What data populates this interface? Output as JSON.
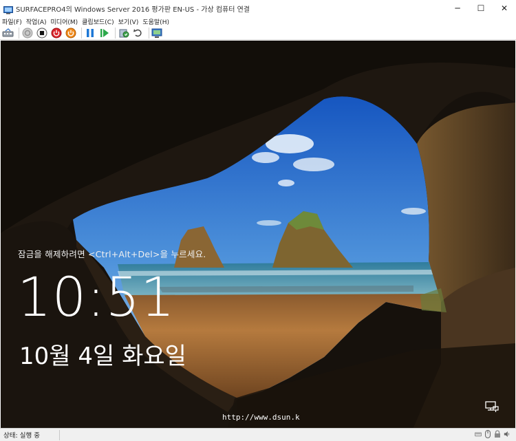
{
  "window": {
    "title": "SURFACEPRO4의 Windows Server 2016 평가판 EN-US - 가상 컴퓨터 연결",
    "minimize_glyph": "─",
    "maximize_glyph": "☐",
    "close_glyph": "✕"
  },
  "menu": {
    "items": [
      {
        "label": "파일(F)"
      },
      {
        "label": "작업(A)"
      },
      {
        "label": "미디어(M)"
      },
      {
        "label": "클립보드(C)"
      },
      {
        "label": "보기(V)"
      },
      {
        "label": "도움말(H)"
      }
    ]
  },
  "toolbar": {
    "icons": [
      "ctrl-alt-del-icon",
      "start-icon",
      "turn-off-icon",
      "shutdown-icon",
      "save-state-icon",
      "pause-icon",
      "resume-icon",
      "checkpoint-icon",
      "revert-icon",
      "enhanced-session-icon"
    ]
  },
  "lockscreen": {
    "unlock_hint": "잠금을 해제하려면 <Ctrl+Alt+Del>을 누르세요.",
    "time": "10:51",
    "date": "10월 4일 화요일",
    "watermark": "http://www.dsun.k"
  },
  "status": {
    "text": "상태: 실행 중"
  },
  "colors": {
    "sky_top": "#1f63c8",
    "sky_bottom": "#8fc0ea",
    "sand": "#b0773d",
    "cave": "#1a140e"
  }
}
